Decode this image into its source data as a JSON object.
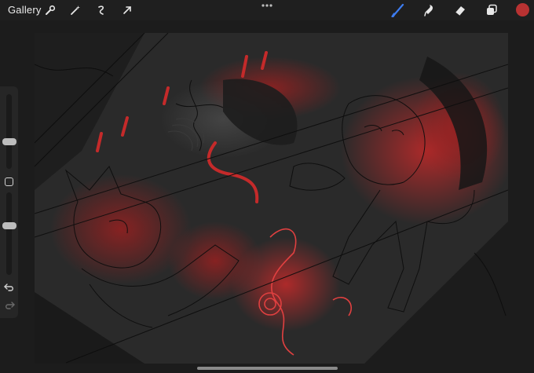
{
  "topbar": {
    "gallery_label": "Gallery",
    "left_tools": [
      "wrench-icon",
      "magic-wand-icon",
      "selection-icon",
      "transform-arrow-icon"
    ],
    "more_icon": "ellipsis-icon",
    "right_tools": [
      "brush-icon",
      "smudge-icon",
      "eraser-icon",
      "layers-icon"
    ],
    "active_tool": "brush-icon",
    "accent_color": "#3d7cf0",
    "current_color": "#b83232"
  },
  "sidebar": {
    "brush_size_fraction": 0.35,
    "opacity_fraction": 0.6,
    "modify_icon": "square-modify-icon",
    "undo_icon": "undo-icon",
    "redo_icon": "redo-icon"
  },
  "canvas": {
    "background_color": "#2b2b2b",
    "accent_paint": "#c42a2a",
    "line_color": "#0d0d0d"
  }
}
